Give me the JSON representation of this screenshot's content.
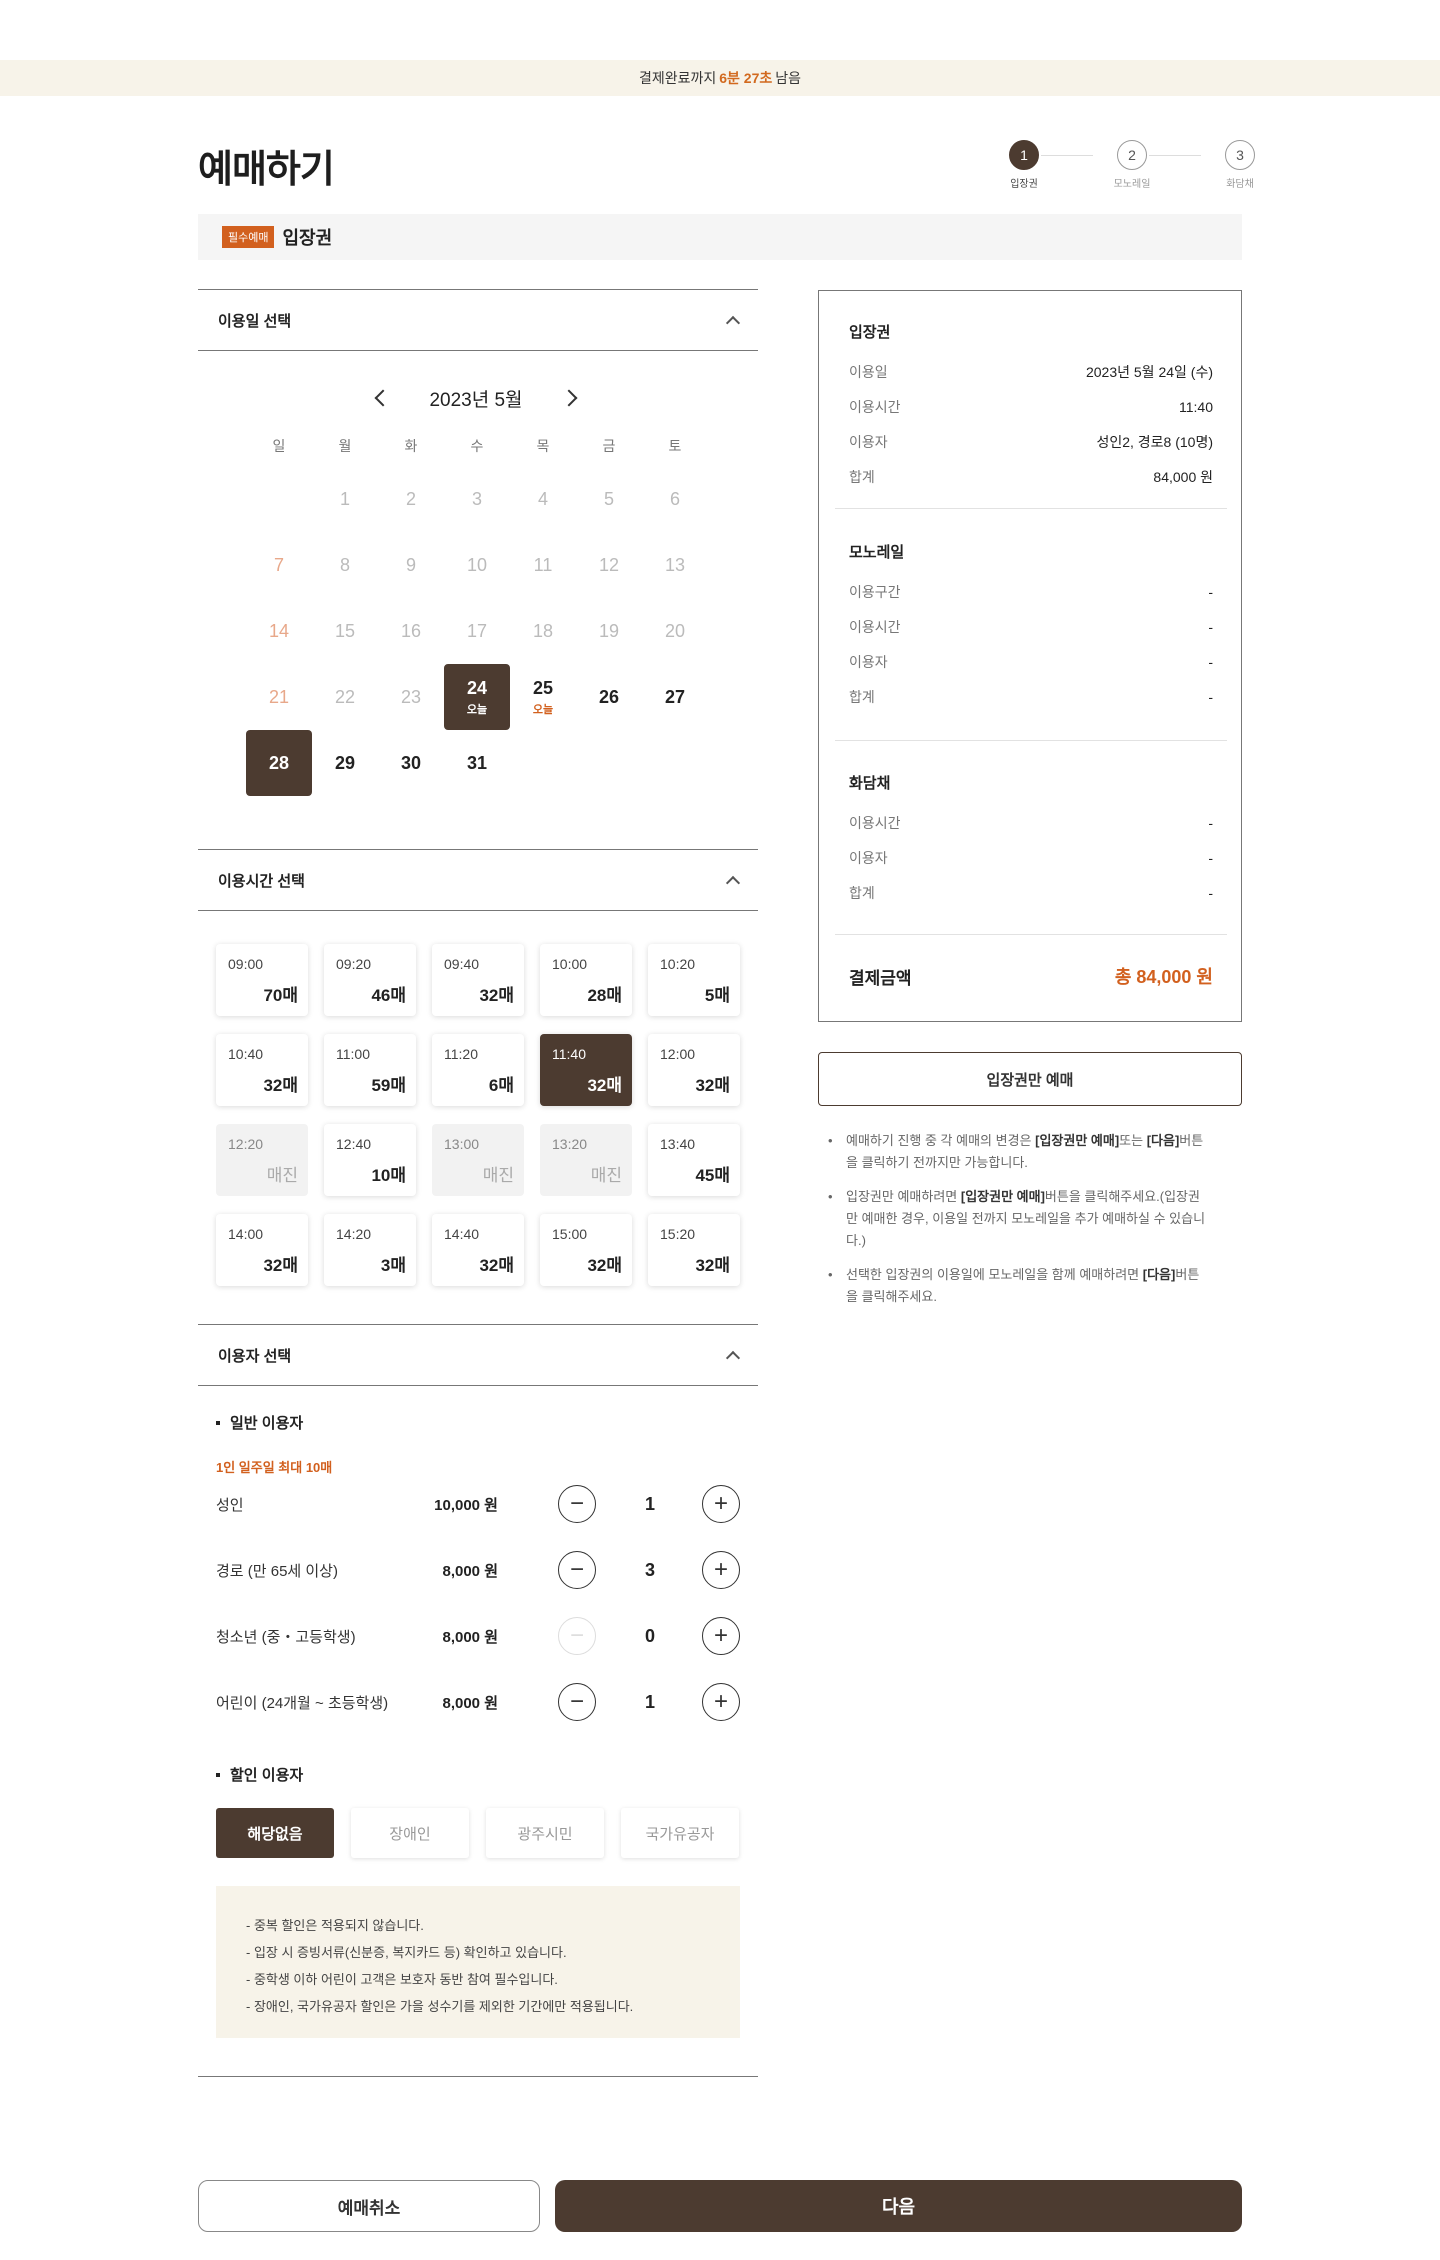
{
  "timer": {
    "prefix": "결제완료까지",
    "time": "6분 27초",
    "suffix": "남음"
  },
  "page_title": "예매하기",
  "steps": [
    {
      "num": "1",
      "label": "입장권"
    },
    {
      "num": "2",
      "label": "모노레일"
    },
    {
      "num": "3",
      "label": "화담채"
    }
  ],
  "section": {
    "badge": "필수예매",
    "title": "입장권"
  },
  "accordions": {
    "date": "이용일 선택",
    "time": "이용시간 선택",
    "user": "이용자 선택"
  },
  "calendar": {
    "month": "2023년 5월",
    "weekdays": [
      "일",
      "월",
      "화",
      "수",
      "목",
      "금",
      "토"
    ],
    "today_label": "오늘",
    "weeks": [
      [
        "",
        "1",
        "2",
        "3",
        "4",
        "5",
        "6"
      ],
      [
        "7",
        "8",
        "9",
        "10",
        "11",
        "12",
        "13"
      ],
      [
        "14",
        "15",
        "16",
        "17",
        "18",
        "19",
        "20"
      ],
      [
        "21",
        "22",
        "23",
        "24",
        "25",
        "26",
        "27"
      ],
      [
        "28",
        "29",
        "30",
        "31",
        "",
        "",
        ""
      ]
    ]
  },
  "time_slots": [
    {
      "time": "09:00",
      "count": "70매"
    },
    {
      "time": "09:20",
      "count": "46매"
    },
    {
      "time": "09:40",
      "count": "32매"
    },
    {
      "time": "10:00",
      "count": "28매"
    },
    {
      "time": "10:20",
      "count": "5매"
    },
    {
      "time": "10:40",
      "count": "32매"
    },
    {
      "time": "11:00",
      "count": "59매"
    },
    {
      "time": "11:20",
      "count": "6매"
    },
    {
      "time": "11:40",
      "count": "32매"
    },
    {
      "time": "12:00",
      "count": "32매"
    },
    {
      "time": "12:20",
      "count": "매진"
    },
    {
      "time": "12:40",
      "count": "10매"
    },
    {
      "time": "13:00",
      "count": "매진"
    },
    {
      "time": "13:20",
      "count": "매진"
    },
    {
      "time": "13:40",
      "count": "45매"
    },
    {
      "time": "14:00",
      "count": "32매"
    },
    {
      "time": "14:20",
      "count": "3매"
    },
    {
      "time": "14:40",
      "count": "32매"
    },
    {
      "time": "15:00",
      "count": "32매"
    },
    {
      "time": "15:20",
      "count": "32매"
    }
  ],
  "users": {
    "general_title": "일반 이용자",
    "limit": "1인 일주일 최대 10매",
    "rows": [
      {
        "name": "성인",
        "price": "10,000 원",
        "qty": "1"
      },
      {
        "name": "경로 (만 65세 이상)",
        "price": "8,000 원",
        "qty": "3"
      },
      {
        "name": "청소년 (중・고등학생)",
        "price": "8,000 원",
        "qty": "0"
      },
      {
        "name": "어린이 (24개월 ~ 초등학생)",
        "price": "8,000 원",
        "qty": "1"
      }
    ],
    "discount_title": "할인 이용자",
    "discounts": [
      "해당없음",
      "장애인",
      "광주시민",
      "국가유공자"
    ],
    "notes": [
      "- 중복 할인은 적용되지 않습니다.",
      "- 입장 시 증빙서류(신분증, 복지카드 등) 확인하고 있습니다.",
      "- 중학생 이하 어린이 고객은 보호자 동반 참여 필수입니다.",
      "- 장애인, 국가유공자 할인은 가을 성수기를 제외한 기간에만 적용됩니다."
    ]
  },
  "summary": {
    "ticket": {
      "title": "입장권",
      "rows": [
        {
          "k": "이용일",
          "v": "2023년 5월 24일 (수)"
        },
        {
          "k": "이용시간",
          "v": "11:40"
        },
        {
          "k": "이용자",
          "v": "성인2, 경로8 (10명)"
        },
        {
          "k": "합계",
          "v": "84,000 원"
        }
      ]
    },
    "monorail": {
      "title": "모노레일",
      "rows": [
        {
          "k": "이용구간",
          "v": "-"
        },
        {
          "k": "이용시간",
          "v": "-"
        },
        {
          "k": "이용자",
          "v": "-"
        },
        {
          "k": "합계",
          "v": "-"
        }
      ]
    },
    "hwadam": {
      "title": "화담채",
      "rows": [
        {
          "k": "이용시간",
          "v": "-"
        },
        {
          "k": "이용자",
          "v": "-"
        },
        {
          "k": "합계",
          "v": "-"
        }
      ]
    },
    "total_label": "결제금액",
    "total_value": "총 84,000 원"
  },
  "ticket_only_button": "입장권만 예매",
  "info": [
    {
      "pre": "예매하기 진행 중 각 예매의 변경은 ",
      "b1": "[입장권만 예매]",
      "mid": "또는 ",
      "b2": "[다음]",
      "post": "버튼을 클릭하기 전까지만 가능합니다."
    },
    {
      "pre": "입장권만 예매하려면 ",
      "b1": "[입장권만 예매]",
      "mid": "버튼을 클릭해주세요.(입장권만 예매한 경우, 이용일 전까지 모노레일을 추가 예매하실 수 있습니다.)",
      "b2": "",
      "post": ""
    },
    {
      "pre": "선택한 입장권의 이용일에 모노레일을 함께 예매하려면 ",
      "b1": "[다음]",
      "mid": "버튼을 클릭해주세요.",
      "b2": "",
      "post": ""
    }
  ],
  "buttons": {
    "cancel": "예매취소",
    "next": "다음"
  }
}
